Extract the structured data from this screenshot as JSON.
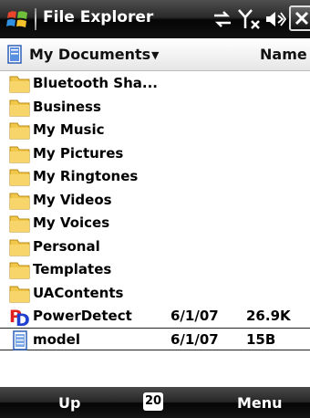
{
  "titlebar": {
    "title": "File Explorer",
    "icons": [
      "windows-start-icon",
      "connectivity-icon",
      "signal-icon",
      "volume-icon",
      "close-icon"
    ]
  },
  "pathbar": {
    "folder": "My Documents",
    "sort": "Name"
  },
  "files": [
    {
      "name": "Bluetooth Sha...",
      "date": "",
      "size": "",
      "icon": "folder-icon"
    },
    {
      "name": "Business",
      "date": "",
      "size": "",
      "icon": "folder-icon"
    },
    {
      "name": "My Music",
      "date": "",
      "size": "",
      "icon": "folder-icon"
    },
    {
      "name": "My Pictures",
      "date": "",
      "size": "",
      "icon": "folder-icon"
    },
    {
      "name": "My Ringtones",
      "date": "",
      "size": "",
      "icon": "folder-icon"
    },
    {
      "name": "My Videos",
      "date": "",
      "size": "",
      "icon": "folder-icon"
    },
    {
      "name": "My Voices",
      "date": "",
      "size": "",
      "icon": "folder-icon"
    },
    {
      "name": "Personal",
      "date": "",
      "size": "",
      "icon": "folder-icon"
    },
    {
      "name": "Templates",
      "date": "",
      "size": "",
      "icon": "folder-icon"
    },
    {
      "name": "UAContents",
      "date": "",
      "size": "",
      "icon": "folder-icon"
    },
    {
      "name": "PowerDetect",
      "date": "6/1/07",
      "size": "26.9K",
      "icon": "powerdetect-app-icon"
    },
    {
      "name": "model",
      "date": "6/1/07",
      "size": "15B",
      "icon": "document-icon",
      "selected": true
    }
  ],
  "softkeys": {
    "left": "Up",
    "badge": "20",
    "right": "Menu"
  },
  "colors": {
    "folder": "#f2c84b",
    "selection_border": "#222222"
  }
}
